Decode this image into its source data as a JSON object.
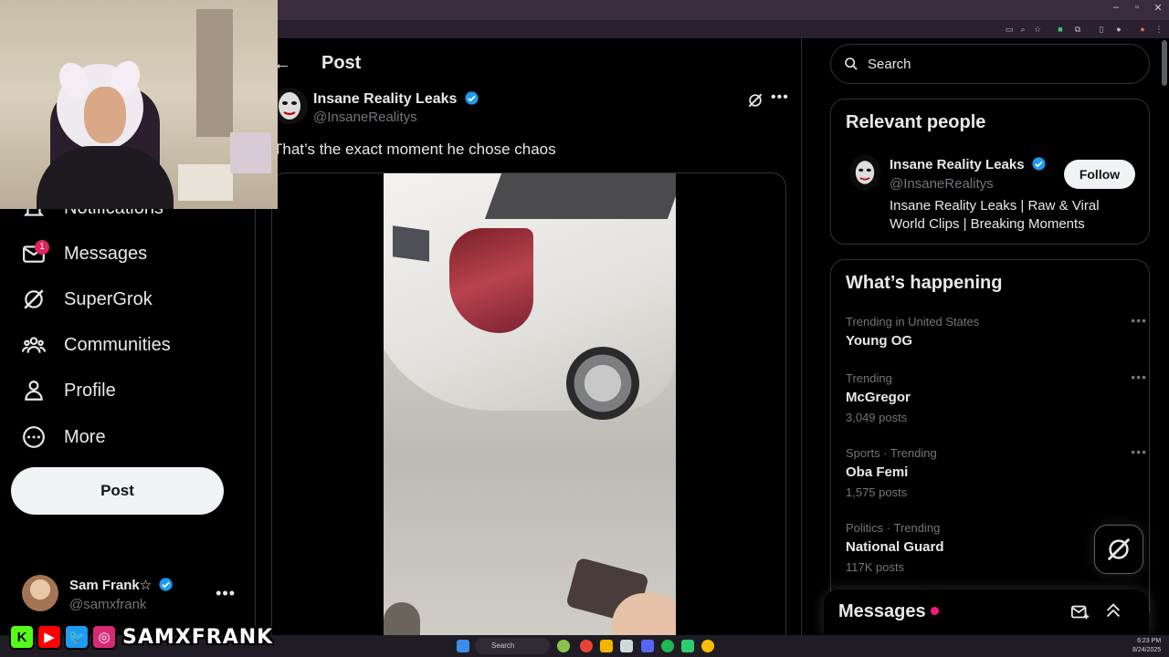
{
  "nav": {
    "notifications": "Notifications",
    "messages": "Messages",
    "messages_badge": "1",
    "supergrok": "SuperGrok",
    "communities": "Communities",
    "profile": "Profile",
    "more": "More",
    "post_button": "Post"
  },
  "account": {
    "name": "Sam Frank☆",
    "handle": "@samxfrank",
    "more": "•••"
  },
  "stream_overlay": {
    "socials": [
      "K",
      "▶",
      "🐦",
      "◎"
    ],
    "handle": "SAMXFRANK"
  },
  "main": {
    "header_title": "Post",
    "tweet": {
      "author_name": "Insane Reality Leaks",
      "author_handle": "@InsaneRealitys",
      "text": "That’s the exact moment he chose chaos",
      "more": "•••"
    }
  },
  "right": {
    "search_placeholder": "Search",
    "relevant_people": {
      "title": "Relevant people",
      "name": "Insane Reality Leaks",
      "handle": "@InsaneRealitys",
      "bio": "Insane Reality Leaks | Raw & Viral World Clips | Breaking Moments",
      "follow": "Follow"
    },
    "happening": {
      "title": "What’s happening",
      "trends": [
        {
          "meta": "Trending in United States",
          "name": "Young OG",
          "count": ""
        },
        {
          "meta": "Trending",
          "name": "McGregor",
          "count": "3,049 posts"
        },
        {
          "meta": "Sports · Trending",
          "name": "Oba Femi",
          "count": "1,575 posts"
        },
        {
          "meta": "Politics · Trending",
          "name": "National Guard",
          "count": "117K posts"
        }
      ]
    },
    "messages_drawer": "Messages"
  },
  "taskbar": {
    "search": "Search",
    "time": "6:23 PM",
    "date": "8/24/2025"
  },
  "colors": {
    "accent_blue": "#1d9bf0",
    "badge_red": "#e0245e",
    "notification_pink": "#f91880",
    "background": "#000000",
    "border": "#2f3336"
  }
}
